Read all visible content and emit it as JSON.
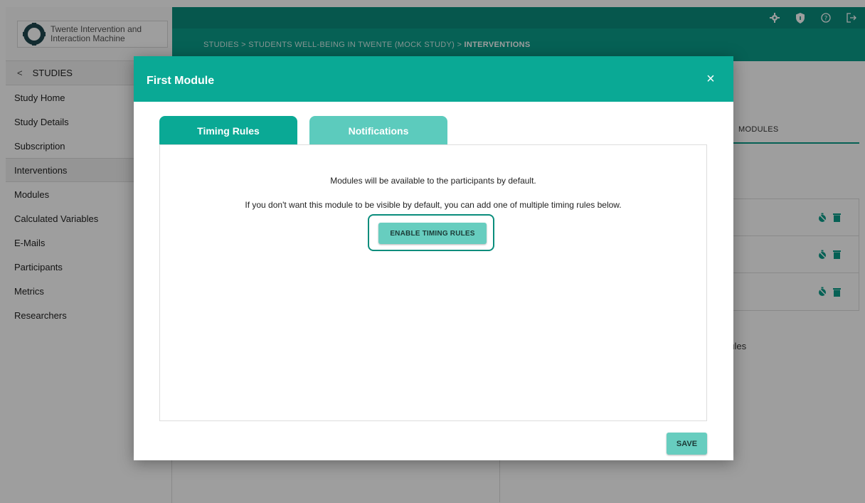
{
  "app": {
    "logo_line1": "Twente Intervention and",
    "logo_line2": "Interaction Machine"
  },
  "header": {
    "breadcrumb_1": "STUDIES",
    "sep_1": ">",
    "breadcrumb_2": "STUDENTS WELL-BEING IN TWENTE (MOCK STUDY)",
    "sep_2": ">",
    "breadcrumb_3": "INTERVENTIONS",
    "icons": [
      "gear-icon",
      "shield-icon",
      "help-icon",
      "logout-icon"
    ]
  },
  "sidebar": {
    "back_label": "STUDIES",
    "items": [
      {
        "label": "Study Home"
      },
      {
        "label": "Study Details"
      },
      {
        "label": "Subscription"
      },
      {
        "label": "Interventions",
        "active": true
      },
      {
        "label": "Modules"
      },
      {
        "label": "Calculated Variables"
      },
      {
        "label": "E-Mails"
      },
      {
        "label": "Participants"
      },
      {
        "label": "Metrics"
      },
      {
        "label": "Researchers"
      }
    ]
  },
  "background": {
    "modules_tab": "MODULES",
    "partial_text": "dules"
  },
  "modal": {
    "title": "First Module",
    "close": "×",
    "tabs": [
      {
        "label": "Timing Rules",
        "active": true
      },
      {
        "label": "Notifications",
        "active": false
      }
    ],
    "info_1": "Modules will be available to the participants by default.",
    "info_2": "If you don't want this module to be visible by default, you can add one of multiple timing rules below.",
    "enable_button": "ENABLE TIMING RULES",
    "save_button": "SAVE"
  },
  "colors": {
    "primary": "#0aa995",
    "primary_dark": "#0a8d7c",
    "tab_inactive": "#5ccbbd",
    "button": "#67cdbf"
  }
}
